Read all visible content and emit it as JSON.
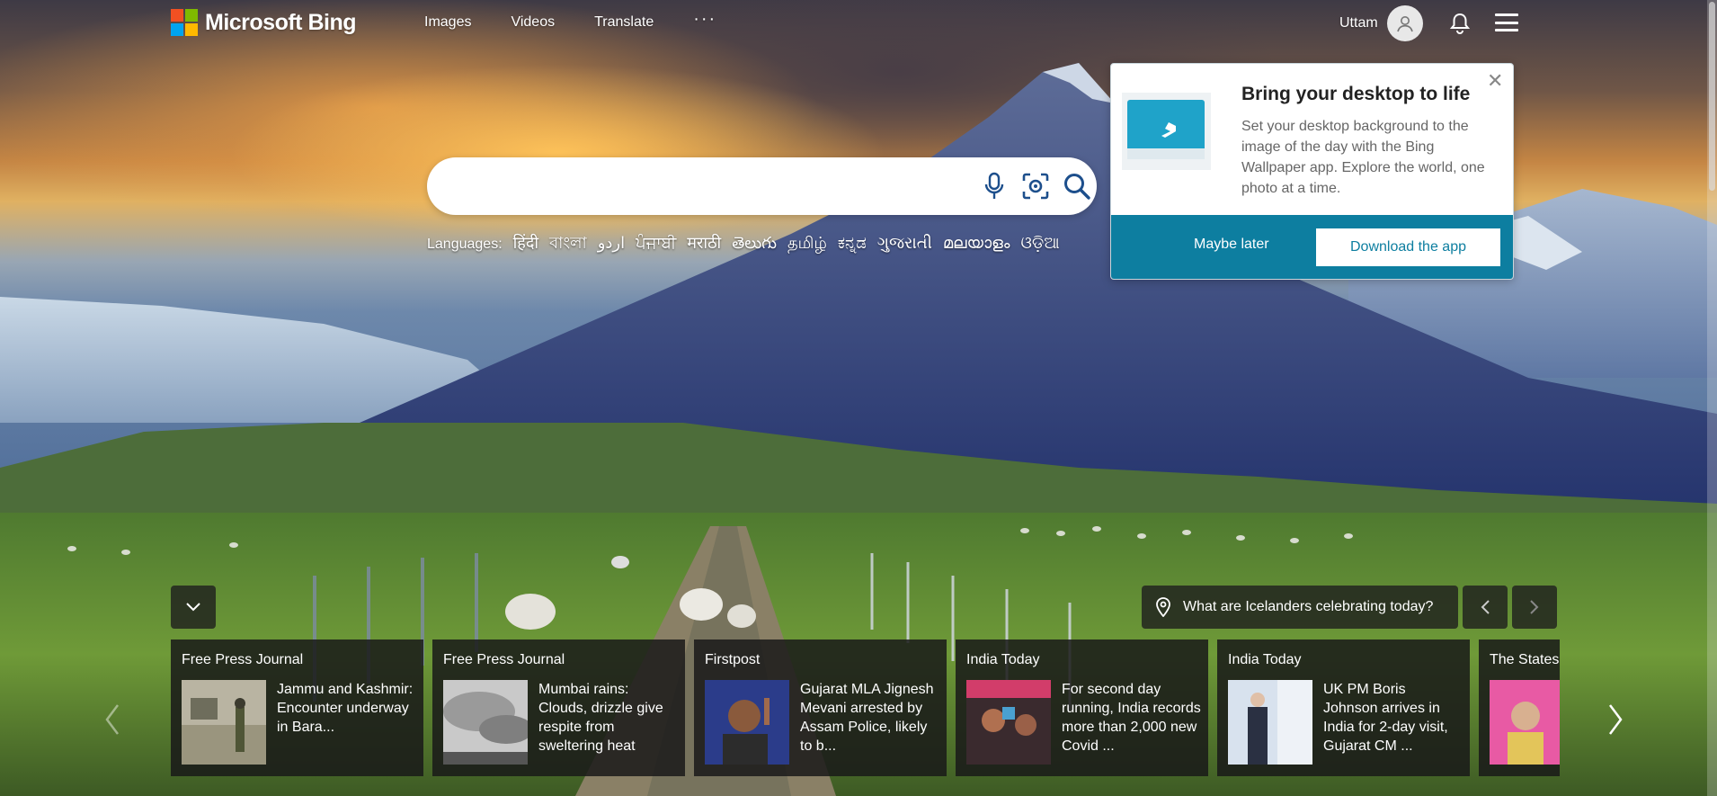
{
  "header": {
    "brand": "Microsoft Bing",
    "nav": [
      "Images",
      "Videos",
      "Translate"
    ],
    "more_label": "···",
    "user_name": "Uttam"
  },
  "search": {
    "placeholder": "",
    "value": ""
  },
  "languages": {
    "label": "Languages:",
    "items": [
      "हिंदी",
      "বাংলা",
      "اردو",
      "ਪੰਜਾਬੀ",
      "मराठी",
      "తెలుగు",
      "தமிழ்",
      "ಕನ್ನಡ",
      "ગુજરાતી",
      "മലയാളം",
      "ଓଡ଼ିଆ"
    ]
  },
  "popup": {
    "title": "Bring your desktop to life",
    "body": "Set your desktop background to the image of the day with the Bing Wallpaper app. Explore the world, one photo at a time.",
    "close": "✕",
    "maybe_later": "Maybe later",
    "download": "Download the app"
  },
  "trivia": {
    "text": "What are Icelanders celebrating today?"
  },
  "news": [
    {
      "source": "Free Press Journal",
      "headline": "Jammu and Kashmir: Encounter underway in Bara..."
    },
    {
      "source": "Free Press Journal",
      "headline": "Mumbai rains: Clouds, drizzle give respite from sweltering heat"
    },
    {
      "source": "Firstpost",
      "headline": "Gujarat MLA Jignesh Mevani arrested by Assam Police, likely to b..."
    },
    {
      "source": "India Today",
      "headline": "For second day running, India records more than 2,000 new Covid ..."
    },
    {
      "source": "India Today",
      "headline": "UK PM Boris Johnson arrives in India for 2-day visit, Gujarat CM ..."
    },
    {
      "source": "The Statesman",
      "headline": ""
    }
  ],
  "colors": {
    "popup_footer": "#0d7ea0",
    "accent": "#0d7ea0"
  },
  "icons": [
    "microphone-icon",
    "visual-search-icon",
    "search-icon",
    "bell-icon",
    "menu-icon",
    "user-icon",
    "location-pin-icon",
    "chevron-left-icon",
    "chevron-right-icon",
    "chevron-down-icon",
    "bing-app-logo"
  ]
}
